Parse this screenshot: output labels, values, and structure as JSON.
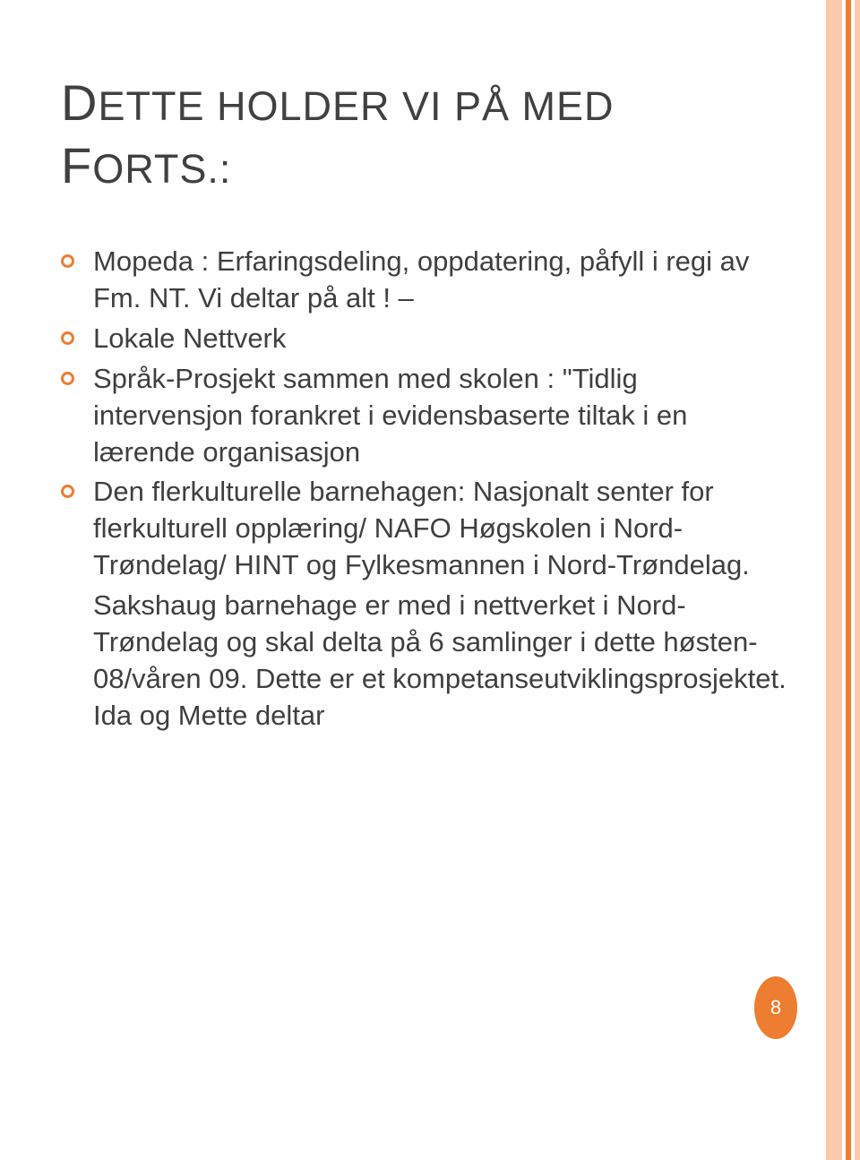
{
  "title_line1_first": "D",
  "title_line1_rest": "ETTE HOLDER VI PÅ MED",
  "title_line2_first": "F",
  "title_line2_rest": "ORTS.:",
  "bullets": [
    "Mopeda : Erfaringsdeling, oppdatering, påfyll i regi av Fm. NT.  Vi deltar på alt ! –",
    "Lokale Nettverk",
    "Språk-Prosjekt sammen med skolen : \"Tidlig intervensjon forankret i evidensbaserte tiltak i en lærende organisasjon",
    "Den flerkulturelle barnehagen: Nasjonalt senter for flerkulturell opplæring/ NAFO  Høgskolen i Nord-Trøndelag/ HINT  og Fylkesmannen i Nord-Trøndelag."
  ],
  "continuation": "Sakshaug barnehage er med i nettverket i Nord-Trøndelag og skal delta på 6 samlinger i dette høsten-08/våren 09. Dette er et kompetanseutviklingsprosjektet. Ida  og Mette deltar",
  "page_number": "8"
}
